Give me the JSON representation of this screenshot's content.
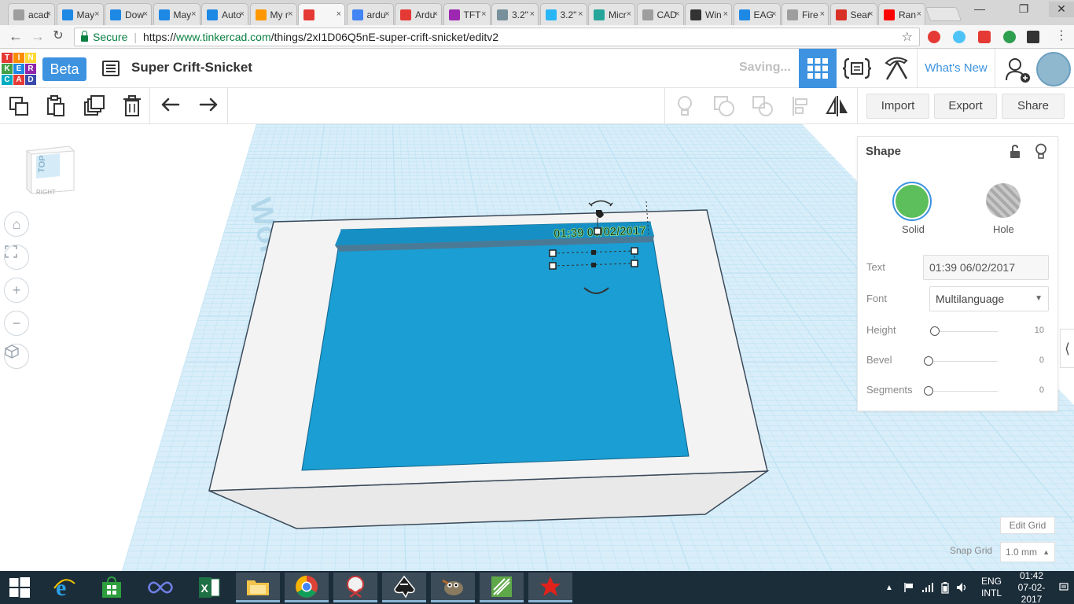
{
  "browser": {
    "tabs": [
      {
        "label": "acad",
        "color": "#9e9e9e"
      },
      {
        "label": "May",
        "color": "#1e88e5"
      },
      {
        "label": "Dow",
        "color": "#1e88e5"
      },
      {
        "label": "May",
        "color": "#1e88e5"
      },
      {
        "label": "Auto",
        "color": "#1e88e5"
      },
      {
        "label": "My r",
        "color": "#ff9800"
      },
      {
        "label": "",
        "color": "#e53935",
        "active": true
      },
      {
        "label": "ardu",
        "color": "#4285f4"
      },
      {
        "label": "Ardu",
        "color": "#e53935"
      },
      {
        "label": "TFT",
        "color": "#9c27b0"
      },
      {
        "label": "3.2\"",
        "color": "#78909c"
      },
      {
        "label": "3.2\"",
        "color": "#29b6f6"
      },
      {
        "label": "Micr",
        "color": "#26a69a"
      },
      {
        "label": "CAD",
        "color": "#9e9e9e"
      },
      {
        "label": "Win",
        "color": "#333333"
      },
      {
        "label": "EAG",
        "color": "#1e88e5"
      },
      {
        "label": "Fire",
        "color": "#9e9e9e"
      },
      {
        "label": "Sear",
        "color": "#d93025"
      },
      {
        "label": "Ran",
        "color": "#ff0000"
      }
    ],
    "address": {
      "secure_label": "Secure",
      "scheme": "https://",
      "host": "www.tinkercad.com",
      "path": "/things/2xI1D06Q5nE-super-crift-snicket/editv2"
    }
  },
  "app": {
    "logo_letters": [
      "T",
      "I",
      "N",
      "K",
      "E",
      "R",
      "C",
      "A",
      "D"
    ],
    "logo_colors": [
      "#e53935",
      "#fb8c00",
      "#fdd835",
      "#43a047",
      "#1e88e5",
      "#8e24aa",
      "#00acc1",
      "#e53935",
      "#3949ab"
    ],
    "beta_label": "Beta",
    "design_name": "Super Crift-Snicket",
    "status": "Saving...",
    "whats_new": "What's New",
    "accent": "#3d93e0"
  },
  "toolbar": {
    "import_label": "Import",
    "export_label": "Export",
    "share_label": "Share"
  },
  "viewcube": {
    "top_label": "TOP",
    "right_label": "RIGHT"
  },
  "workplane": {
    "label": "Workplane",
    "grid_color": "#bfe3f4",
    "plane_color": "#d9eef9"
  },
  "scene": {
    "text_value": "01:39 06/02/2017",
    "box_color": "#f2f2f2",
    "cavity_color": "#1a9ed3"
  },
  "shape_panel": {
    "title": "Shape",
    "solid_label": "Solid",
    "hole_label": "Hole",
    "text_label": "Text",
    "text_value": "01:39 06/02/2017",
    "font_label": "Font",
    "font_value": "Multilanguage",
    "height_label": "Height",
    "height_value": "10",
    "bevel_label": "Bevel",
    "bevel_value": "0",
    "segments_label": "Segments",
    "segments_value": "0"
  },
  "grid": {
    "edit_label": "Edit Grid",
    "snap_label": "Snap Grid",
    "snap_value": "1.0 mm"
  },
  "taskbar": {
    "lang_top": "ENG",
    "lang_bottom": "INTL",
    "time": "01:42",
    "date": "07-02-2017"
  }
}
